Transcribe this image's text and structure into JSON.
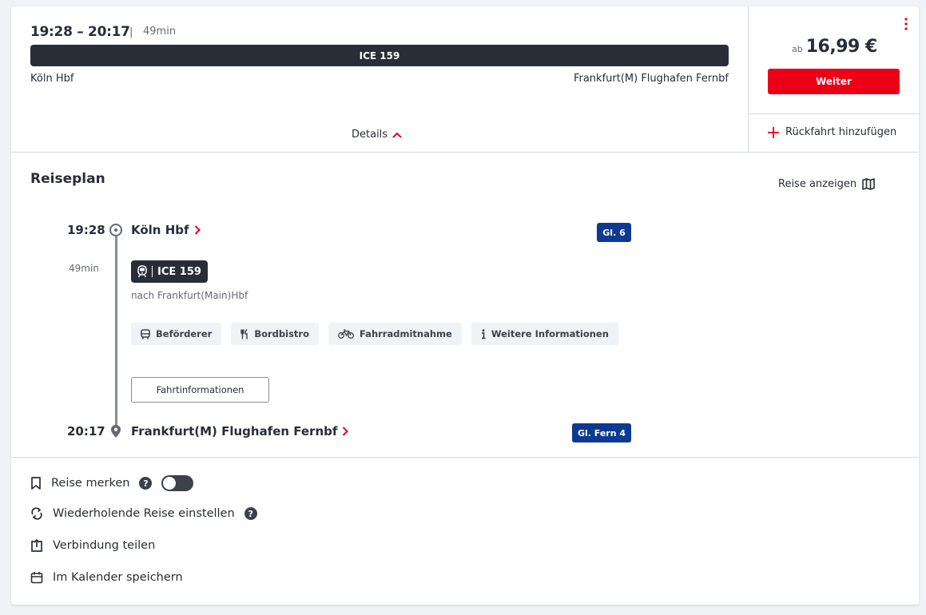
{
  "connection": {
    "time_range": "19:28 – 20:17",
    "separator": "|",
    "duration": "49min",
    "train": "ICE 159",
    "from": "Köln Hbf",
    "to": "Frankfurt(M) Flughafen Fernbf",
    "details_label": "Details"
  },
  "offer": {
    "price_prefix": "ab",
    "price": "16,99 €",
    "continue_label": "Weiter",
    "return_label": "Rückfahrt hinzufügen"
  },
  "plan": {
    "title": "Reiseplan",
    "show_journey_label": "Reise anzeigen",
    "departure": {
      "time": "19:28",
      "station": "Köln Hbf",
      "platform": "Gl. 6"
    },
    "duration": "49min",
    "train": {
      "name": "ICE 159",
      "direction": "nach Frankfurt(Main)Hbf"
    },
    "chips": [
      {
        "label": "Beförderer",
        "icon": "bus-icon"
      },
      {
        "label": "Bordbistro",
        "icon": "cutlery-icon"
      },
      {
        "label": "Fahrradmitnahme",
        "icon": "bicycle-icon"
      },
      {
        "label": "Weitere Informationen",
        "icon": "info-icon"
      }
    ],
    "trip_info_label": "Fahrtinformationen",
    "arrival": {
      "time": "20:17",
      "station": "Frankfurt(M) Flughafen Fernbf",
      "platform": "Gl. Fern 4"
    }
  },
  "actions": [
    {
      "label": "Reise merken",
      "icon": "bookmark-icon"
    },
    {
      "label": "Wiederholende Reise einstellen",
      "icon": "repeat-icon"
    },
    {
      "label": "Verbindung teilen",
      "icon": "share-icon"
    },
    {
      "label": "Im Kalender speichern",
      "icon": "calendar-icon"
    }
  ],
  "help_glyph": "?",
  "colors": {
    "accent": "#ec0016",
    "dark": "#282d37",
    "platform": "#0c3992",
    "muted": "#646973"
  }
}
